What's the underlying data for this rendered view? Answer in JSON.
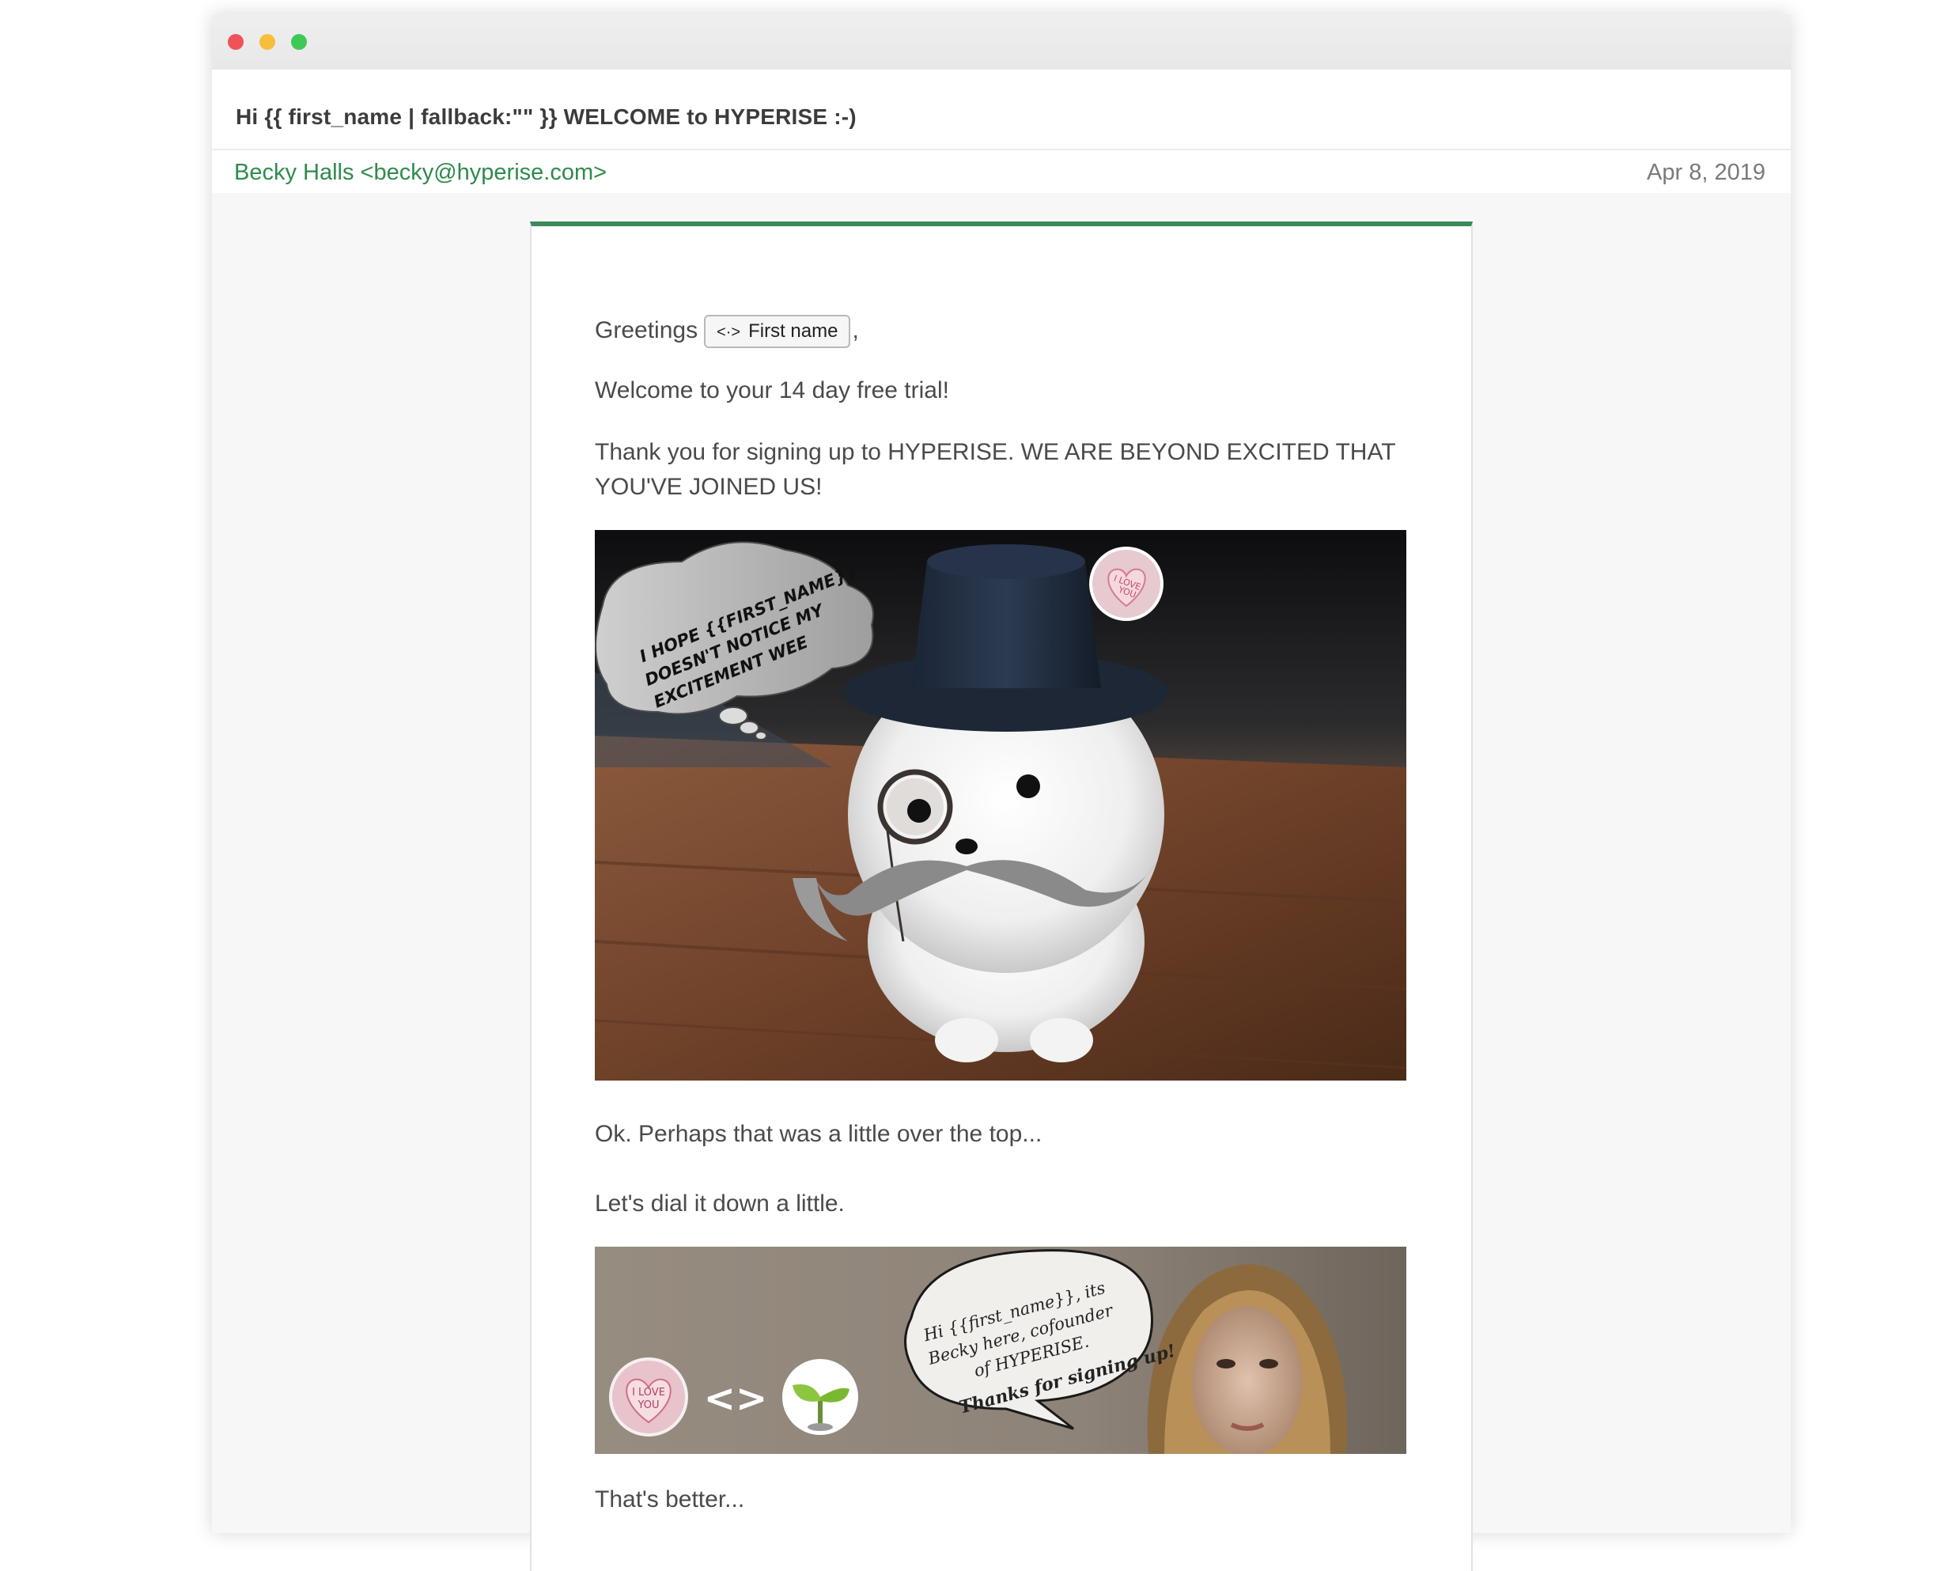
{
  "window": {
    "subject": "Hi {{ first_name | fallback:\"\" }} WELCOME to HYPERISE :-)",
    "sender": "Becky Halls <becky@hyperise.com>",
    "date": "Apr 8, 2019"
  },
  "email": {
    "greeting": "Greetings",
    "first_name_chip": "First name",
    "chip_icon": "<·>",
    "greeting_punct": ",",
    "welcome": "Welcome to your 14 day free trial!",
    "thanks_line1": "Thank you for signing up to HYPERISE. WE ARE BEYOND EXCITED THAT",
    "thanks_line2": "YOU'VE JOINED US!",
    "dog_bubble": [
      "I HOPE {{FIRST_NAME}}",
      "DOESN'T NOTICE MY",
      "EXCITEMENT WEE"
    ],
    "badge_text": [
      "I LOVE",
      "YOU"
    ],
    "over_the_top": "Ok. Perhaps that was a little over the top...",
    "dial_down": "Let's dial it down a little.",
    "banner_bubble": [
      "Hi {{first_name}}, its",
      "Becky here, cofounder",
      "of HYPERISE.",
      "Thanks for signing up!"
    ],
    "banner_badge": [
      "I LOVE",
      "YOU"
    ],
    "banner_code": "<>",
    "better": "That's better..."
  },
  "colors": {
    "accent_green": "#3b8a58",
    "sender_green": "#2e8b4c",
    "close_red": "#f0525a",
    "minimize_yellow": "#f7be3c",
    "zoom_green": "#3ec956"
  }
}
